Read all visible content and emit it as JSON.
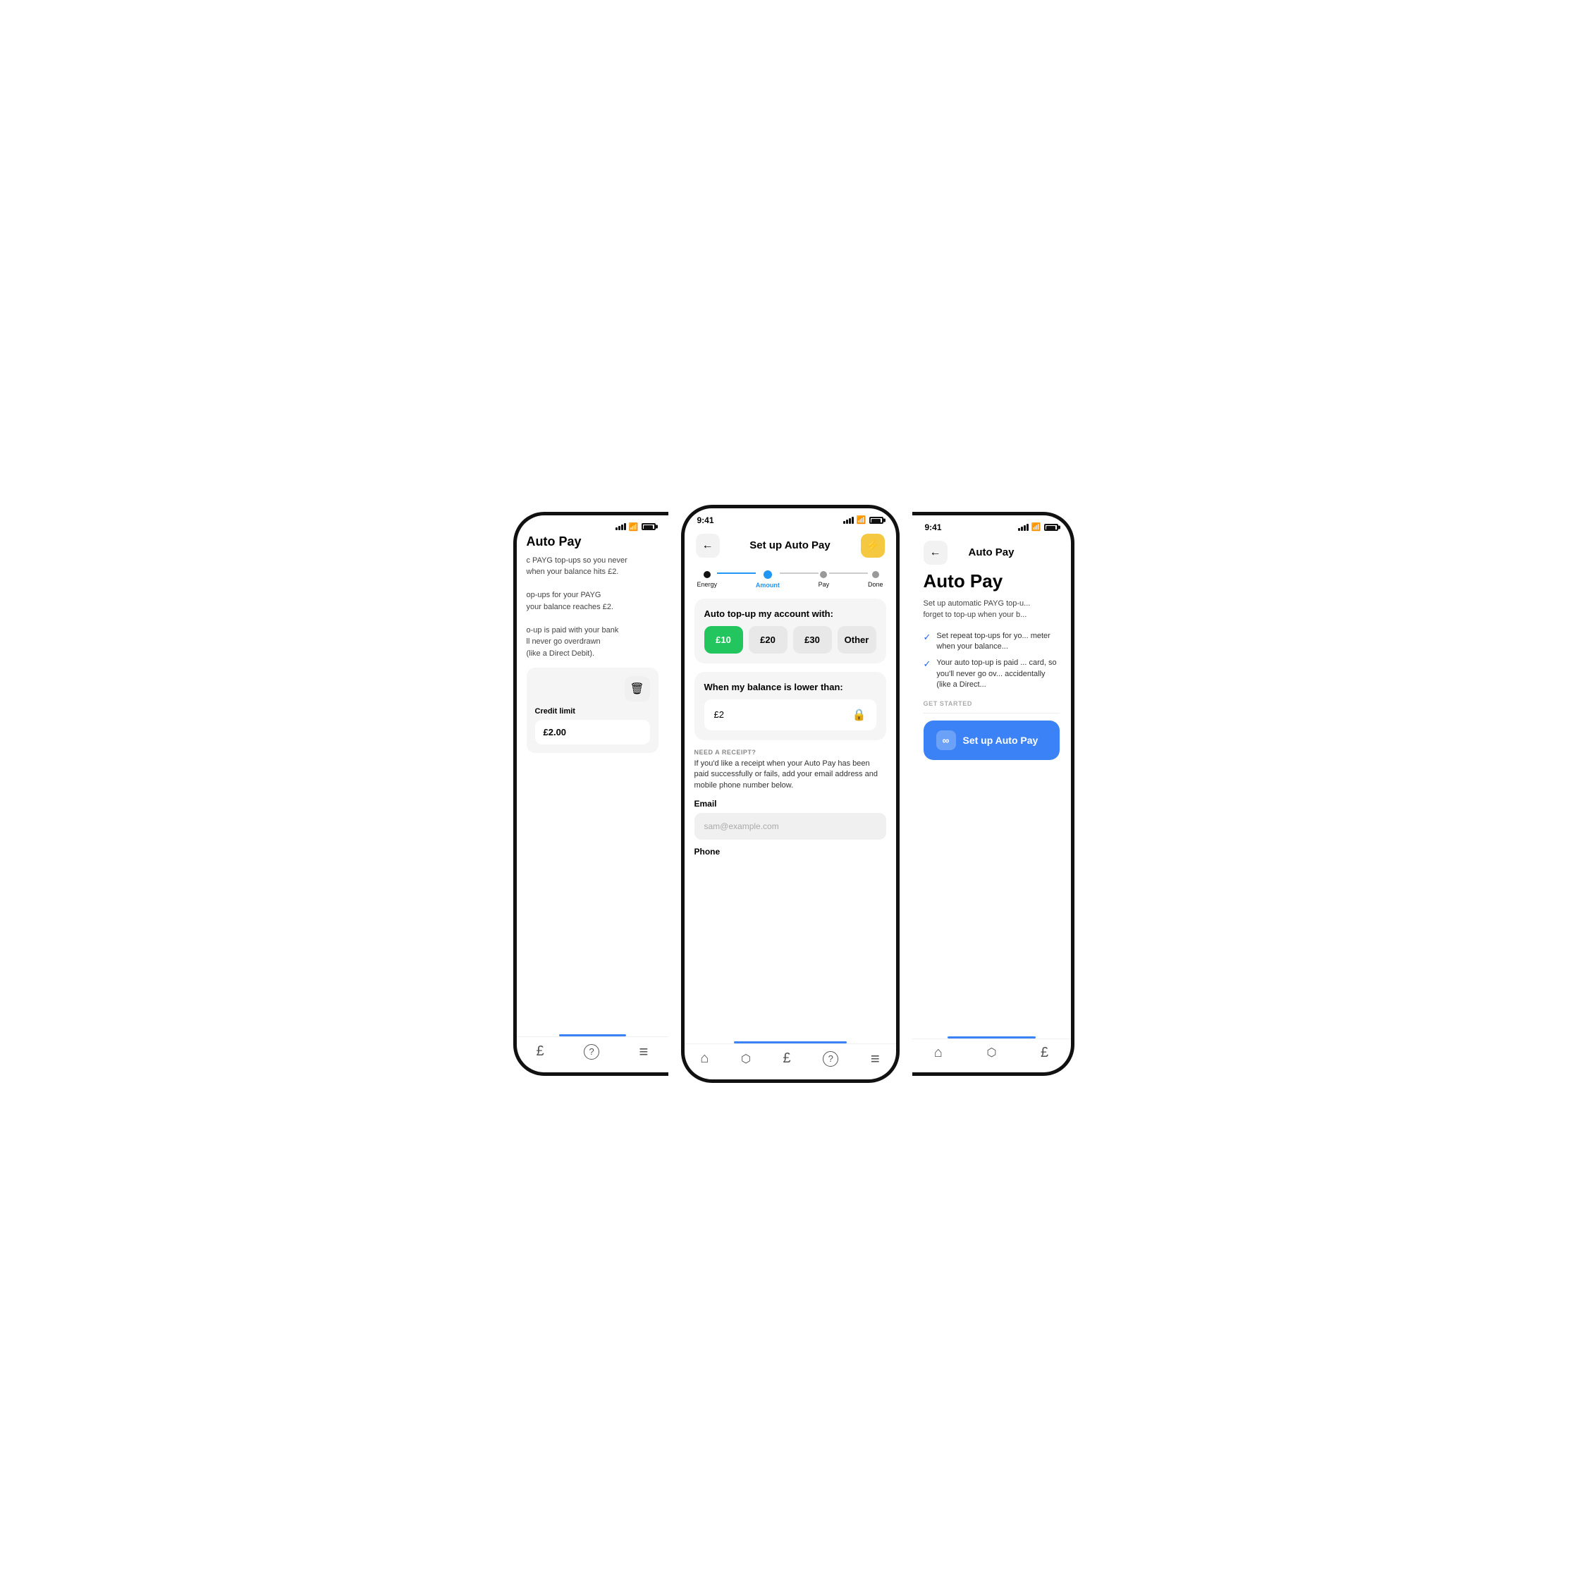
{
  "phones": {
    "left": {
      "status": "",
      "title": "Auto Pay",
      "description_lines": [
        "c PAYG top-ups so you never",
        "when your balance hits £2.",
        "",
        "op-ups for your PAYG",
        "your balance reaches £2.",
        "",
        "o-up is paid with your bank",
        "ll never go overdrawn",
        "(like a Direct Debit)."
      ],
      "delete_label": "🗑",
      "credit_limit_label": "Credit limit",
      "credit_limit_value": "£2.00",
      "nav_items": [
        "£",
        "?",
        "≡"
      ]
    },
    "center": {
      "time": "9:41",
      "back_label": "←",
      "title": "Set up Auto Pay",
      "lightning": "⚡",
      "steps": [
        {
          "label": "Energy",
          "state": "done"
        },
        {
          "label": "Amount",
          "state": "active"
        },
        {
          "label": "Pay",
          "state": "inactive"
        },
        {
          "label": "Done",
          "state": "inactive"
        }
      ],
      "amount_section": {
        "title": "Auto top-up my account with:",
        "options": [
          "£10",
          "£20",
          "£30",
          "Other"
        ],
        "selected": "£10"
      },
      "balance_section": {
        "title": "When my balance is lower than:",
        "value": "£2"
      },
      "receipt_section": {
        "label": "NEED A RECEIPT?",
        "description": "If you'd like a receipt when your Auto Pay has been paid successfully or fails, add your email address and mobile phone number below.",
        "email_label": "Email",
        "email_placeholder": "sam@example.com",
        "phone_label": "Phone"
      },
      "nav_items": [
        "⌂",
        "∿",
        "£",
        "?",
        "≡"
      ]
    },
    "right": {
      "time": "9:41",
      "back_label": "←",
      "title": "Auto Pay",
      "page_title": "Auto Pay",
      "description": "Set up automatic PAYG top-u... forget to top-up when your b...",
      "check_items": [
        "Set repeat top-ups for yo... meter when your balance...",
        "Your auto top-up is paid ... card, so you'll never go ov... accidentally (like a Direct..."
      ],
      "get_started_label": "GET STARTED",
      "setup_btn_label": "Set up Auto Pay",
      "setup_btn_icon": "∞",
      "nav_items": [
        "⌂",
        "∿",
        "£"
      ]
    }
  }
}
